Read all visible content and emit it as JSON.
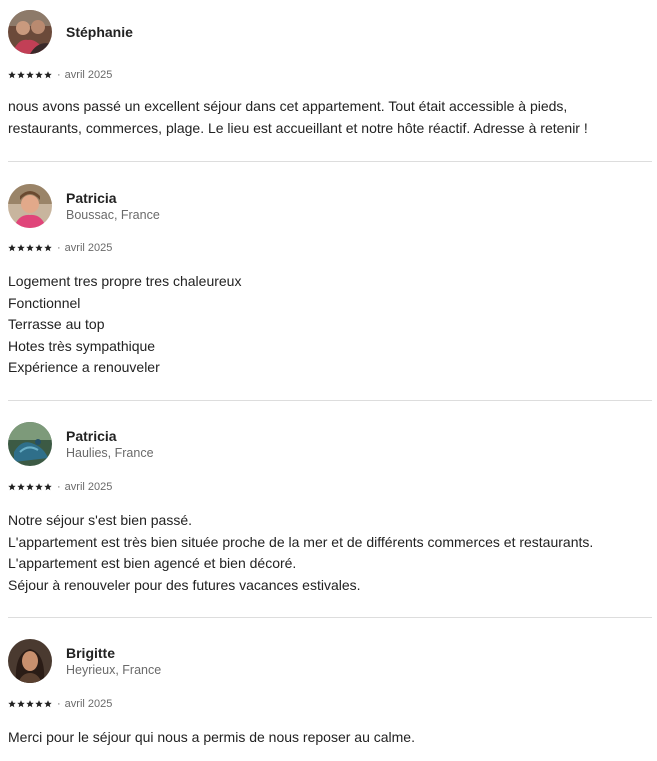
{
  "reviews": [
    {
      "name": "Stéphanie",
      "location": "",
      "rating": 5,
      "date": "avril 2025",
      "separator": "·",
      "lines": [
        "nous avons passé un excellent séjour dans cet appartement. Tout était accessible à pieds,",
        "restaurants, commerces, plage. Le lieu est accueillant et notre hôte réactif. Adresse à retenir !"
      ]
    },
    {
      "name": "Patricia",
      "location": "Boussac, France",
      "rating": 5,
      "date": "avril 2025",
      "separator": "·",
      "lines": [
        "Logement tres propre tres chaleureux",
        "Fonctionnel",
        "Terrasse au top",
        "Hotes très sympathique",
        "Expérience a renouveler"
      ]
    },
    {
      "name": "Patricia",
      "location": "Haulies, France",
      "rating": 5,
      "date": "avril 2025",
      "separator": "·",
      "lines": [
        "Notre séjour s'est bien passé.",
        "L'appartement est très bien située proche de la mer et de différents commerces et restaurants.",
        "L'appartement est bien agencé et bien décoré.",
        "Séjour à renouveler pour des futures vacances estivales."
      ]
    },
    {
      "name": "Brigitte",
      "location": "Heyrieux, France",
      "rating": 5,
      "date": "avril 2025",
      "separator": "·",
      "lines": [
        "Merci pour le séjour qui nous a permis de nous reposer au calme."
      ]
    }
  ],
  "colors": {
    "text": "#222222",
    "muted": "#6a6a6a",
    "divider": "#dddddd",
    "star": "#222222"
  },
  "icons": {
    "star": "star-icon",
    "avatar": "user-avatar"
  }
}
